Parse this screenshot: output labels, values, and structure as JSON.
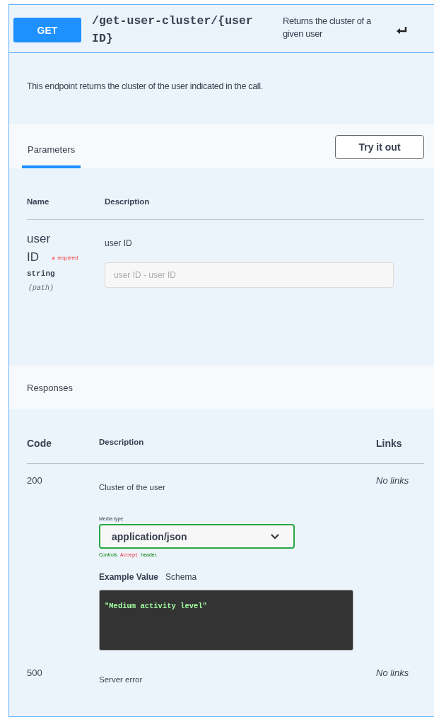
{
  "operation": {
    "method": "GET",
    "path": "/get-user-cluster/{user ID}",
    "summary": "Returns the cluster of a given user",
    "description": "This endpoint returns the cluster of the user indicated in the call."
  },
  "parameters": {
    "tabs": [
      {
        "label": "Parameters",
        "selected": true
      }
    ],
    "try_button": "Try it out",
    "columns": [
      "Name",
      "Description"
    ],
    "rows": [
      {
        "name": "user ID",
        "required_mark": "*",
        "required_label": "required",
        "type": "string",
        "location": "(path)",
        "description": "user ID",
        "placeholder": "user ID - user ID"
      }
    ]
  },
  "responses": {
    "title": "Responses",
    "columns": [
      "Code",
      "Description",
      "Links"
    ],
    "rows": [
      {
        "code": "200",
        "description": "Cluster of the user",
        "links": "No links",
        "media": {
          "label": "Media type",
          "value": "application/json",
          "note_before": "Controls",
          "note_code": "Accept",
          "note_after": "header.",
          "tabs": [
            {
              "label": "Example Value",
              "selected": true
            },
            {
              "label": "Schema",
              "selected": false
            }
          ],
          "example": "\"Medium activity level\""
        }
      },
      {
        "code": "500",
        "description": "Server error",
        "links": "No links"
      }
    ]
  }
}
